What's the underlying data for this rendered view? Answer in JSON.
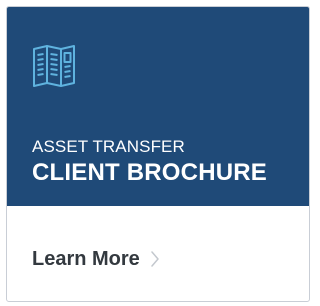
{
  "card": {
    "eyebrow": "ASSET TRANSFER",
    "headline": "CLIENT BROCHURE",
    "icon": "brochure-icon",
    "link_label": "Learn More",
    "link_icon": "chevron-right-icon"
  },
  "colors": {
    "banner": "#1f4a78",
    "icon_accent": "#5fb3df",
    "text_light": "#ffffff",
    "text_dark": "#33393f",
    "border": "#c9ced6"
  }
}
